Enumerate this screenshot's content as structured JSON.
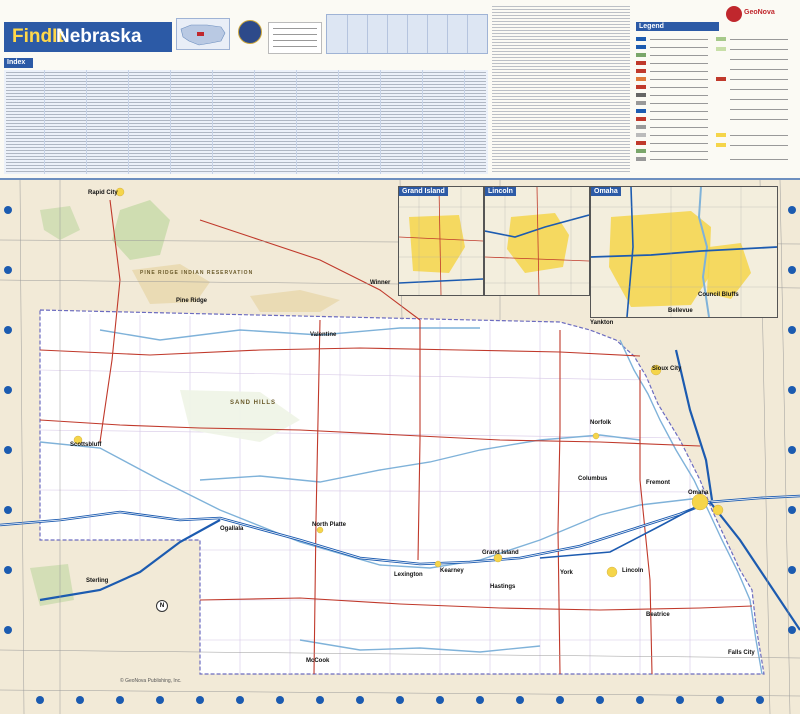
{
  "header": {
    "brand": "FindIt",
    "state": "Nebraska",
    "index_title": "Index",
    "legend_title": "Legend",
    "publisher_logo": "GeoNova"
  },
  "insets": [
    {
      "label": "Grand Island"
    },
    {
      "label": "Lincoln"
    },
    {
      "label": "Omaha"
    }
  ],
  "cities": {
    "rapid_city": "Rapid City",
    "sioux_city": "Sioux City",
    "scottsbluff": "Scottsbluff",
    "north_platte": "North Platte",
    "grand_island": "Grand Island",
    "lincoln": "Lincoln",
    "omaha": "Omaha",
    "kearney": "Kearney",
    "norfolk": "Norfolk",
    "columbus": "Columbus",
    "council_bluffs": "Council Bluffs",
    "bellevue": "Bellevue",
    "yankton": "Yankton",
    "hastings": "Hastings",
    "mccook": "McCook",
    "beatrice": "Beatrice",
    "sterling": "Sterling",
    "winner": "Winner",
    "pine_ridge": "Pine Ridge",
    "valentine": "Valentine",
    "lexington": "Lexington",
    "falls_city": "Falls City",
    "ogallala": "Ogallala",
    "fremont": "Fremont",
    "york": "York"
  },
  "regions": {
    "sand_hills": "SAND HILLS",
    "pine_ridge_res": "PINE RIDGE INDIAN RESERVATION"
  },
  "copyright": "© GeoNova Publishing, Inc.",
  "compass_letter": "N",
  "colors": {
    "header_blue": "#2c5aa6",
    "state_fill": "#ffffff",
    "surround_fill": "#f2ead7",
    "interstate": "#1c5bb0",
    "highway_red": "#c0392b",
    "water": "#7fb2d9",
    "urban": "#f5d54a"
  }
}
